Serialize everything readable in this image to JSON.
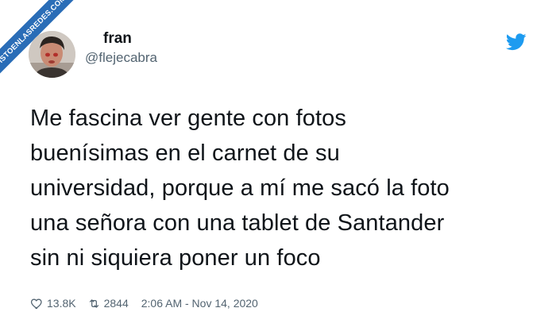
{
  "watermark": {
    "text": "VISTOENLASREDES.COM"
  },
  "user": {
    "display_name": "fran",
    "handle": "@flejecabra"
  },
  "tweet": {
    "lines": [
      "Me fascina ver gente con fotos",
      "buenísimas en el carnet de su",
      "universidad, porque a mí me sacó la foto",
      "una señora con una tablet de Santander",
      "sin ni siquiera poner un foco"
    ]
  },
  "stats": {
    "likes": "13.8K",
    "retweets": "2844",
    "timestamp": "2:06 AM - Nov 14, 2020"
  },
  "icons": {
    "brand": "twitter-bird-icon",
    "like": "heart-icon",
    "retweet": "retweet-icon"
  },
  "colors": {
    "twitter_blue": "#1d9bf0",
    "ribbon_blue": "#2a6db7",
    "text": "#0f1419",
    "muted": "#536471"
  }
}
